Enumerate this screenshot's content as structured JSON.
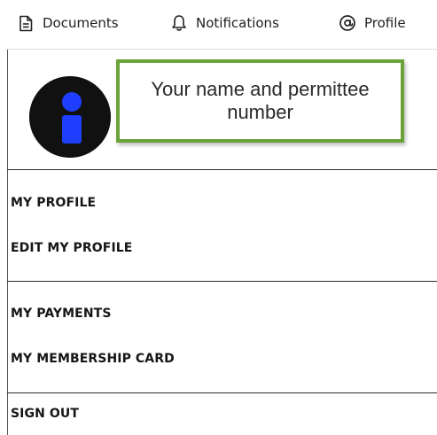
{
  "topnav": {
    "items": [
      {
        "label": "Documents",
        "icon": "document-icon"
      },
      {
        "label": "Notifications",
        "icon": "bell-icon"
      },
      {
        "label": "Profile",
        "icon": "at-sign-icon"
      }
    ]
  },
  "profile_panel": {
    "callout_text": "Your name and permittee number",
    "callout_border_color": "#6aa23a",
    "avatar_colors": {
      "background": "#111111",
      "figure": "#1f3fff"
    }
  },
  "menu": {
    "groups": [
      {
        "items": [
          {
            "label": "MY PROFILE"
          },
          {
            "label": "EDIT MY PROFILE"
          }
        ]
      },
      {
        "items": [
          {
            "label": "MY PAYMENTS"
          },
          {
            "label": "MY MEMBERSHIP CARD"
          }
        ]
      },
      {
        "items": [
          {
            "label": "SIGN OUT"
          }
        ]
      }
    ]
  }
}
